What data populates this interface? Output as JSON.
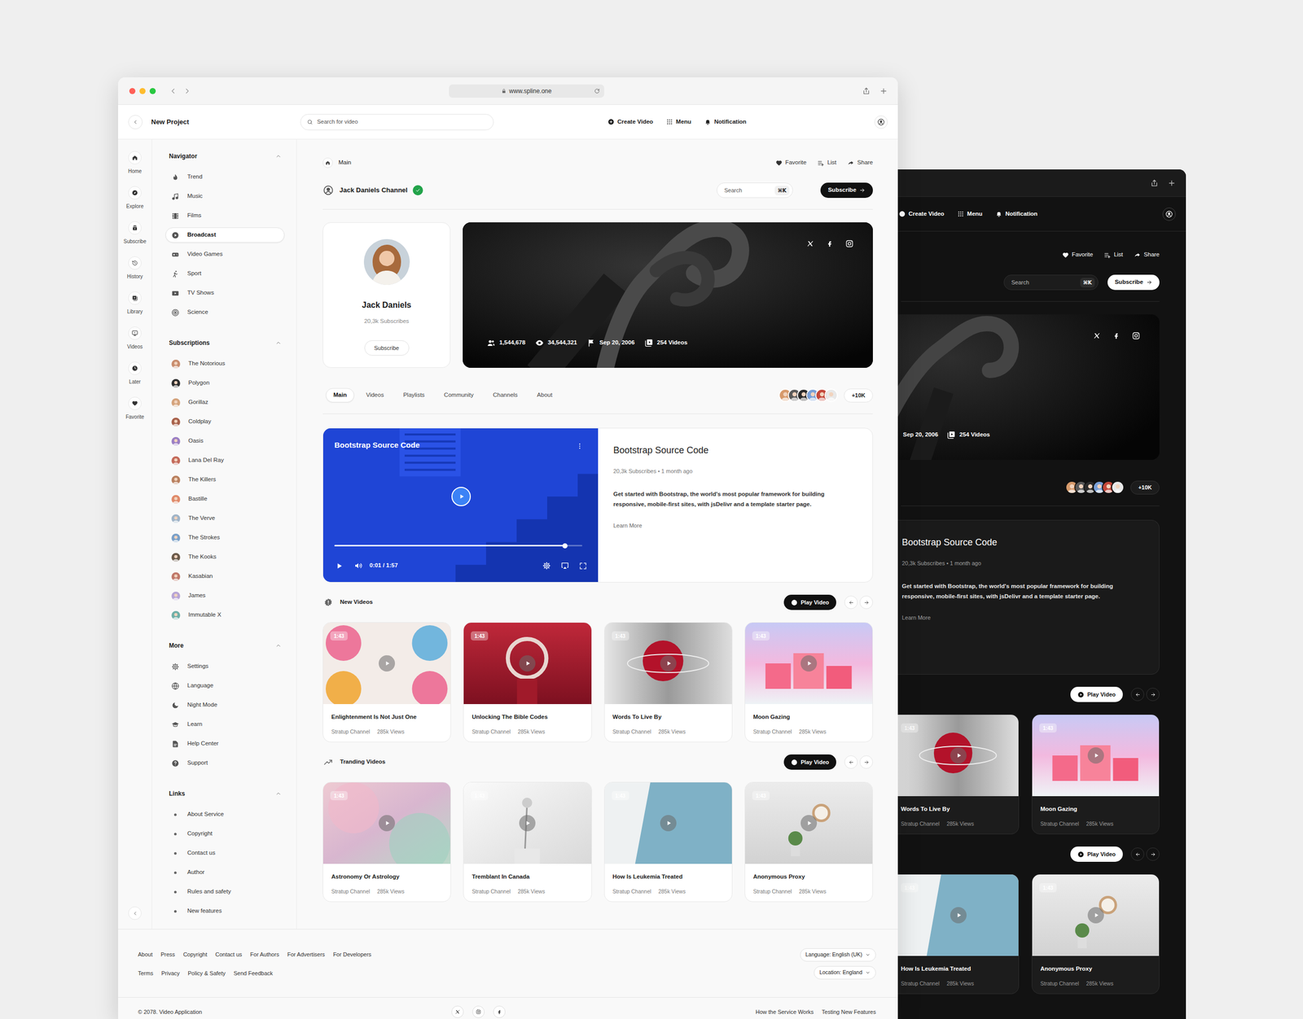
{
  "browser": {
    "url": "www.spline.one"
  },
  "header": {
    "title": "New Project",
    "search_placeholder": "Search for video",
    "actions": [
      "Create Video",
      "Menu",
      "Notification"
    ]
  },
  "rail": [
    "Home",
    "Explore",
    "Subscribe",
    "History",
    "Library",
    "Videos",
    "Later",
    "Favorite"
  ],
  "sidebar": [
    {
      "title": "Navigator",
      "expanded": true,
      "kind": "icons",
      "items": [
        {
          "label": "Trend",
          "selected": false
        },
        {
          "label": "Music",
          "selected": false
        },
        {
          "label": "Films",
          "selected": false
        },
        {
          "label": "Broadcast",
          "selected": true
        },
        {
          "label": "Video Games",
          "selected": false
        },
        {
          "label": "Sport",
          "selected": false
        },
        {
          "label": "TV Shows",
          "selected": false
        },
        {
          "label": "Science",
          "selected": false
        }
      ]
    },
    {
      "title": "Subscriptions",
      "expanded": true,
      "kind": "avatars",
      "items": [
        {
          "label": "The Notorious",
          "selected": false
        },
        {
          "label": "Polygon",
          "selected": false
        },
        {
          "label": "Gorillaz",
          "selected": false
        },
        {
          "label": "Coldplay",
          "selected": false
        },
        {
          "label": "Oasis",
          "selected": false
        },
        {
          "label": "Lana Del Ray",
          "selected": false
        },
        {
          "label": "The Killers",
          "selected": false
        },
        {
          "label": "Bastille",
          "selected": false
        },
        {
          "label": "The Verve",
          "selected": false
        },
        {
          "label": "The Strokes",
          "selected": false
        },
        {
          "label": "The Kooks",
          "selected": false
        },
        {
          "label": "Kasabian",
          "selected": false
        },
        {
          "label": "James",
          "selected": false
        },
        {
          "label": "Immutable X",
          "selected": false
        }
      ]
    },
    {
      "title": "More",
      "expanded": true,
      "kind": "icons",
      "items": [
        {
          "label": "Settings",
          "selected": false
        },
        {
          "label": "Language",
          "selected": false
        },
        {
          "label": "Night Mode",
          "selected": false
        },
        {
          "label": "Learn",
          "selected": false
        },
        {
          "label": "Help Center",
          "selected": false
        },
        {
          "label": "Support",
          "selected": false
        }
      ]
    },
    {
      "title": "Links",
      "expanded": true,
      "kind": "bullets",
      "items": [
        {
          "label": "About Service",
          "selected": false
        },
        {
          "label": "Copyright",
          "selected": false
        },
        {
          "label": "Contact us",
          "selected": false
        },
        {
          "label": "Author",
          "selected": false
        },
        {
          "label": "Rules and safety",
          "selected": false
        },
        {
          "label": "New features",
          "selected": false
        }
      ]
    }
  ],
  "breadcrumb": {
    "label": "Main",
    "actions": [
      "Favorite",
      "List",
      "Share"
    ]
  },
  "channel": {
    "name": "Jack Daniels Channel",
    "verified": true,
    "search_placeholder": "Search",
    "shortcut": "⌘K",
    "subscribe": "Subscribe"
  },
  "profile": {
    "name": "Jack Daniels",
    "subscribers": "20,3k Subscribes",
    "button": "Subscribe"
  },
  "banner": {
    "stats": [
      "1,544,678",
      "34,544,321",
      "Sep 20, 2006",
      "254 Videos"
    ]
  },
  "tabs": [
    {
      "label": "Main",
      "selected": true
    },
    {
      "label": "Videos",
      "selected": false
    },
    {
      "label": "Playlists",
      "selected": false
    },
    {
      "label": "Community",
      "selected": false
    },
    {
      "label": "Channels",
      "selected": false
    },
    {
      "label": "About",
      "selected": false
    }
  ],
  "followers": "+10K",
  "featured": {
    "overlay_title": "Bootstrap Source Code",
    "time": "0:01 / 1:57",
    "level": 0.93,
    "title": "Bootstrap Source Code",
    "meta": "20,3k Subscribes • 1 month ago",
    "description": "Get started with Bootstrap, the world's most popular framework for building responsive, mobile-first sites, with jsDelivr and a template starter page.",
    "link": "Learn More"
  },
  "sections": [
    {
      "title": "New Videos",
      "button": "Play Video",
      "videos": [
        {
          "title": "Enlightenment Is Not Just One",
          "channel": "Stratup Channel",
          "views": "285k Views",
          "duration": "1:43"
        },
        {
          "title": "Unlocking The Bible Codes",
          "channel": "Stratup Channel",
          "views": "285k Views",
          "duration": "1:43"
        },
        {
          "title": "Words To Live By",
          "channel": "Stratup Channel",
          "views": "285k Views",
          "duration": "1:43"
        },
        {
          "title": "Moon Gazing",
          "channel": "Stratup Channel",
          "views": "285k Views",
          "duration": "1:43"
        }
      ]
    },
    {
      "title": "Tranding Videos",
      "button": "Play Video",
      "videos": [
        {
          "title": "Astronomy Or Astrology",
          "channel": "Stratup Channel",
          "views": "285k Views",
          "duration": "1:43"
        },
        {
          "title": "Tremblant In Canada",
          "channel": "Stratup Channel",
          "views": "285k Views",
          "duration": "1:43"
        },
        {
          "title": "How Is Leukemia Treated",
          "channel": "Stratup Channel",
          "views": "285k Views",
          "duration": "1:43"
        },
        {
          "title": "Anonymous Proxy",
          "channel": "Stratup Channel",
          "views": "285k Views",
          "duration": "1:43"
        }
      ]
    }
  ],
  "footer": {
    "links": [
      [
        "About",
        "Press",
        "Copyright",
        "Contact us",
        "For Authors",
        "For Advertisers",
        "For Developers"
      ],
      [
        "Terms",
        "Privacy",
        "Policy & Safety",
        "Send Feedback"
      ]
    ],
    "language": "Language: English (UK)",
    "location": "Location: England",
    "copyright": "© 2078. Video Application",
    "bottom_links": [
      "How the Service Works",
      "Testing New Features"
    ]
  },
  "dark_window": {
    "actions": [
      "Create Video",
      "Menu",
      "Notification"
    ],
    "page_actions": [
      "Favorite",
      "List",
      "Share"
    ],
    "search_placeholder": "Search",
    "shortcut": "⌘K",
    "subscribe": "Subscribe",
    "banner_stats": [
      "Sep 20, 2006",
      "254 Videos"
    ],
    "followers": "+10K",
    "featured": {
      "title": "Bootstrap Source Code",
      "meta": "20,3k Subscribes • 1 month ago",
      "description": "Get started with Bootstrap, the world's most popular framework for building responsive, mobile-first sites, with jsDelivr and a template starter page.",
      "link": "Learn More"
    },
    "sections": [
      {
        "button": "Play Video",
        "videos": [
          {
            "title": "Words To Live By",
            "channel": "Stratup Channel",
            "views": "285k Views",
            "duration": "1:43"
          },
          {
            "title": "Moon Gazing",
            "channel": "Stratup Channel",
            "views": "285k Views",
            "duration": "1:43"
          }
        ]
      },
      {
        "button": "Play Video",
        "videos": [
          {
            "title": "How Is Leukemia Treated",
            "channel": "Stratup Channel",
            "views": "285k Views",
            "duration": "1:43"
          },
          {
            "title": "Anonymous Proxy",
            "channel": "Stratup Channel",
            "views": "285k Views",
            "duration": "1:43"
          }
        ]
      }
    ]
  }
}
